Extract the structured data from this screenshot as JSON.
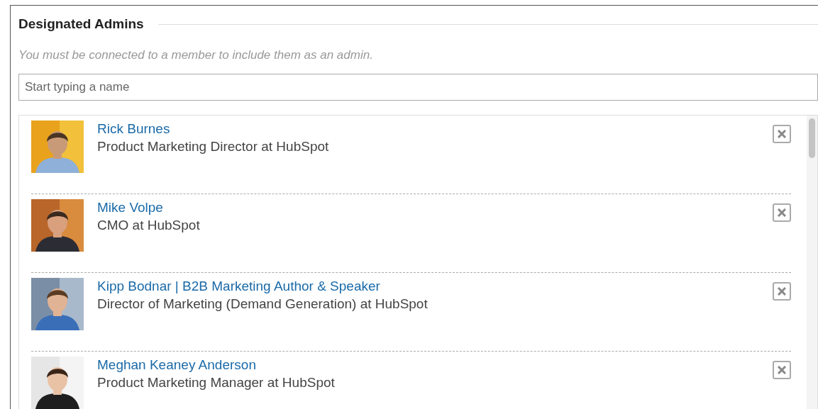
{
  "section": {
    "title": "Designated Admins",
    "note": "You must be connected to a member to include them as an admin."
  },
  "search": {
    "placeholder": "Start typing a name"
  },
  "admins": [
    {
      "name": "Rick Burnes",
      "headline": "Product Marketing Director at HubSpot"
    },
    {
      "name": "Mike Volpe",
      "headline": "CMO at HubSpot"
    },
    {
      "name": "Kipp Bodnar | B2B Marketing Author & Speaker",
      "headline": "Director of Marketing (Demand Generation) at HubSpot"
    },
    {
      "name": "Meghan Keaney Anderson",
      "headline": "Product Marketing Manager at HubSpot"
    }
  ]
}
